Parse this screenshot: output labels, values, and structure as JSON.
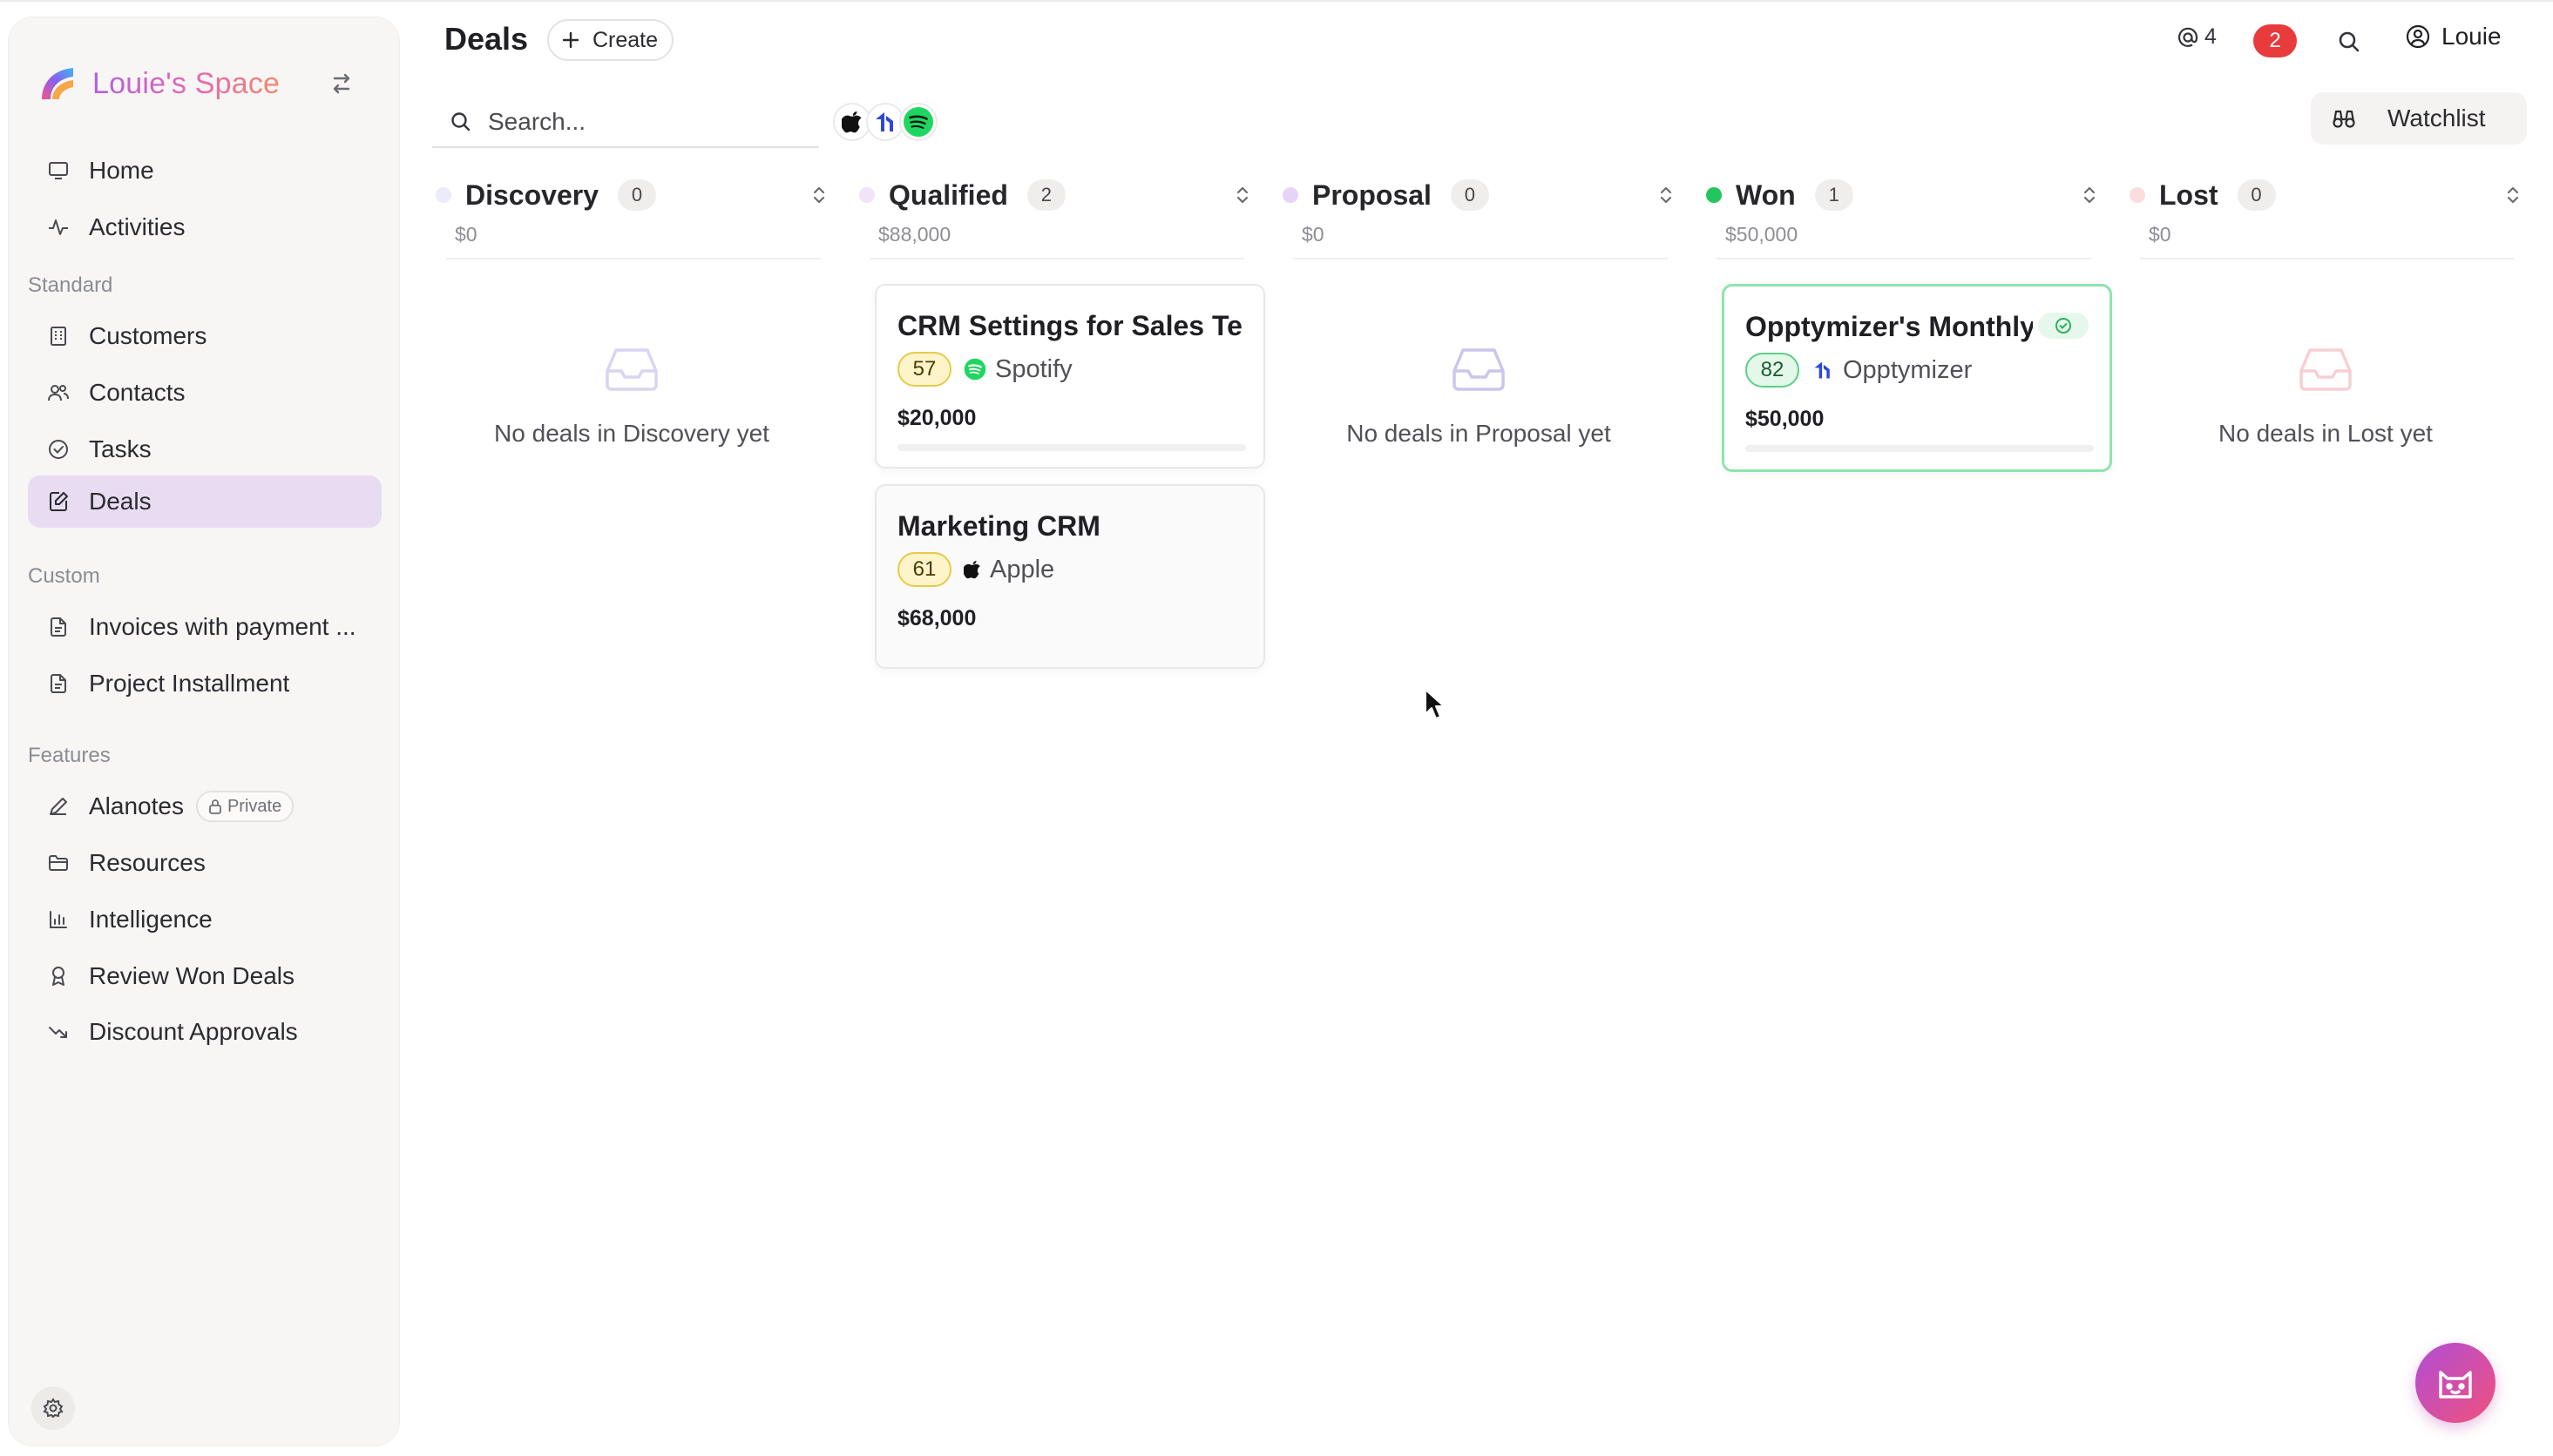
{
  "app": {
    "name": "Louie's Space",
    "brand_colors": [
      "#b45fe0",
      "#e86aa8",
      "#f08a6c"
    ]
  },
  "sidebar": {
    "primary": [
      {
        "label": "Home",
        "icon": "monitor-icon"
      },
      {
        "label": "Activities",
        "icon": "activity-icon"
      }
    ],
    "sections": [
      {
        "title": "Standard",
        "items": [
          {
            "label": "Customers",
            "icon": "building-icon"
          },
          {
            "label": "Contacts",
            "icon": "users-icon"
          },
          {
            "label": "Tasks",
            "icon": "check-circle-icon"
          },
          {
            "label": "Deals",
            "icon": "edit-document-icon",
            "active": true
          }
        ]
      },
      {
        "title": "Custom",
        "items": [
          {
            "label": "Invoices with payment ...",
            "icon": "document-icon"
          },
          {
            "label": "Project Installment",
            "icon": "document-icon"
          }
        ]
      },
      {
        "title": "Features",
        "items": [
          {
            "label": "Alanotes",
            "icon": "pen-icon",
            "badge": "Private"
          },
          {
            "label": "Resources",
            "icon": "folder-icon"
          },
          {
            "label": "Intelligence",
            "icon": "bar-chart-icon"
          },
          {
            "label": "Review Won Deals",
            "icon": "award-icon"
          },
          {
            "label": "Discount Approvals",
            "icon": "trend-down-icon"
          }
        ]
      }
    ]
  },
  "header": {
    "title": "Deals",
    "create_label": "Create",
    "mentions_count": "4",
    "notifications_count": "2",
    "user_name": "Louie",
    "search_placeholder": "Search...",
    "watchlist_label": "Watchlist",
    "company_filters": [
      "apple-icon",
      "opptymizer-icon",
      "spotify-icon"
    ]
  },
  "columns": [
    {
      "name": "Discovery",
      "count": "0",
      "total": "$0",
      "dot_color": "#ecebfb",
      "empty_text": "No deals in Discovery yet",
      "empty_icon_color": "#d9d4f1"
    },
    {
      "name": "Qualified",
      "count": "2",
      "total": "$88,000",
      "dot_color": "#f1e3fa"
    },
    {
      "name": "Proposal",
      "count": "0",
      "total": "$0",
      "dot_color": "#e7d3f7",
      "empty_text": "No deals in Proposal yet",
      "empty_icon_color": "#ccc5ec"
    },
    {
      "name": "Won",
      "count": "1",
      "total": "$50,000",
      "dot_color": "#22c55e"
    },
    {
      "name": "Lost",
      "count": "0",
      "total": "$0",
      "dot_color": "#fbdde0",
      "empty_text": "No deals in Lost yet",
      "empty_icon_color": "#f6cfd4"
    }
  ],
  "deals": {
    "qualified": [
      {
        "title": "CRM Settings for Sales Te",
        "score": "57",
        "company": "Spotify",
        "amount": "$20,000"
      },
      {
        "title": "Marketing CRM",
        "score": "61",
        "company": "Apple",
        "amount": "$68,000"
      }
    ],
    "won": [
      {
        "title": "Opptymizer's Monthly",
        "score": "82",
        "company": "Opptymizer",
        "amount": "$50,000"
      }
    ]
  }
}
